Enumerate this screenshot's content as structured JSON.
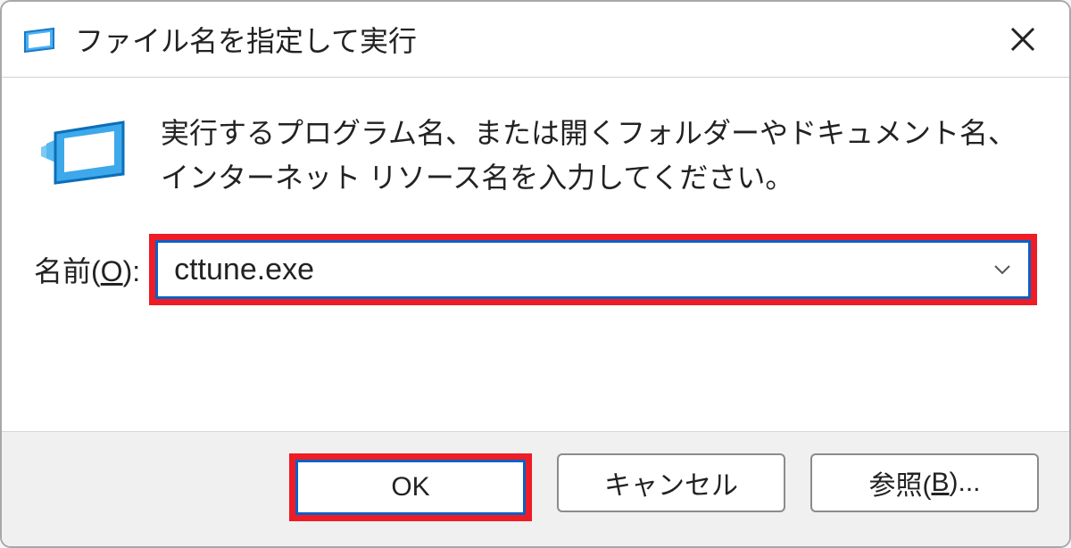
{
  "dialog": {
    "title": "ファイル名を指定して実行",
    "instruction": "実行するプログラム名、または開くフォルダーやドキュメント名、インターネット リソース名を入力してください。",
    "input_label_prefix": "名前(",
    "input_label_accel": "O",
    "input_label_suffix": "):",
    "input_value": "cttune.exe",
    "ok_label": "OK",
    "cancel_label": "キャンセル",
    "browse_label_prefix": "参照(",
    "browse_label_accel": "B",
    "browse_label_suffix": ")...",
    "highlight_color": "#ee1c25",
    "accent_color": "#0a60c7"
  }
}
